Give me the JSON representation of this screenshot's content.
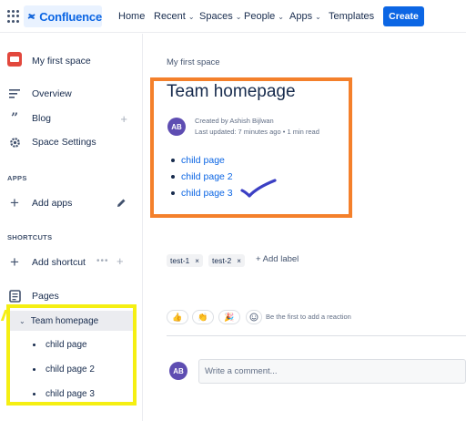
{
  "topnav": {
    "logo_text": "Confluence",
    "items": [
      {
        "label": "Home",
        "dropdown": false
      },
      {
        "label": "Recent",
        "dropdown": true
      },
      {
        "label": "Spaces",
        "dropdown": true
      },
      {
        "label": "People",
        "dropdown": true
      },
      {
        "label": "Apps",
        "dropdown": true
      },
      {
        "label": "Templates",
        "dropdown": false
      }
    ],
    "create_label": "Create",
    "accent": "#0c66e4"
  },
  "sidebar": {
    "space_name": "My first space",
    "items": [
      {
        "label": "Overview",
        "icon": "overview-icon"
      },
      {
        "label": "Blog",
        "icon": "quote-icon"
      },
      {
        "label": "Space Settings",
        "icon": "gear-icon"
      }
    ],
    "apps_heading": "APPS",
    "add_apps": "Add apps",
    "shortcuts_heading": "SHORTCUTS",
    "add_shortcut": "Add shortcut",
    "pages_label": "Pages",
    "tree_root": "Team homepage",
    "tree_children": [
      "child page",
      "child page 2",
      "child page 3"
    ]
  },
  "main": {
    "breadcrumb": "My first space",
    "title": "Team homepage",
    "avatar_initials": "AB",
    "created_by": "Created by Ashish Bijlwan",
    "last_updated": "Last updated: 7 minutes ago • 1 min read",
    "children": [
      "child page",
      "child page 2",
      "child page 3"
    ],
    "labels": [
      "test-1",
      "test-2"
    ],
    "add_label": "+ Add label",
    "reactions": [
      "👍",
      "👏",
      "🎉"
    ],
    "reaction_prompt": "Be the first to add a reaction",
    "comment_placeholder": "Write a comment..."
  },
  "annotation_colors": {
    "highlight_yellow": "#f5ef12",
    "highlight_orange": "#f4802b",
    "check_blue": "#3b3fc4"
  }
}
